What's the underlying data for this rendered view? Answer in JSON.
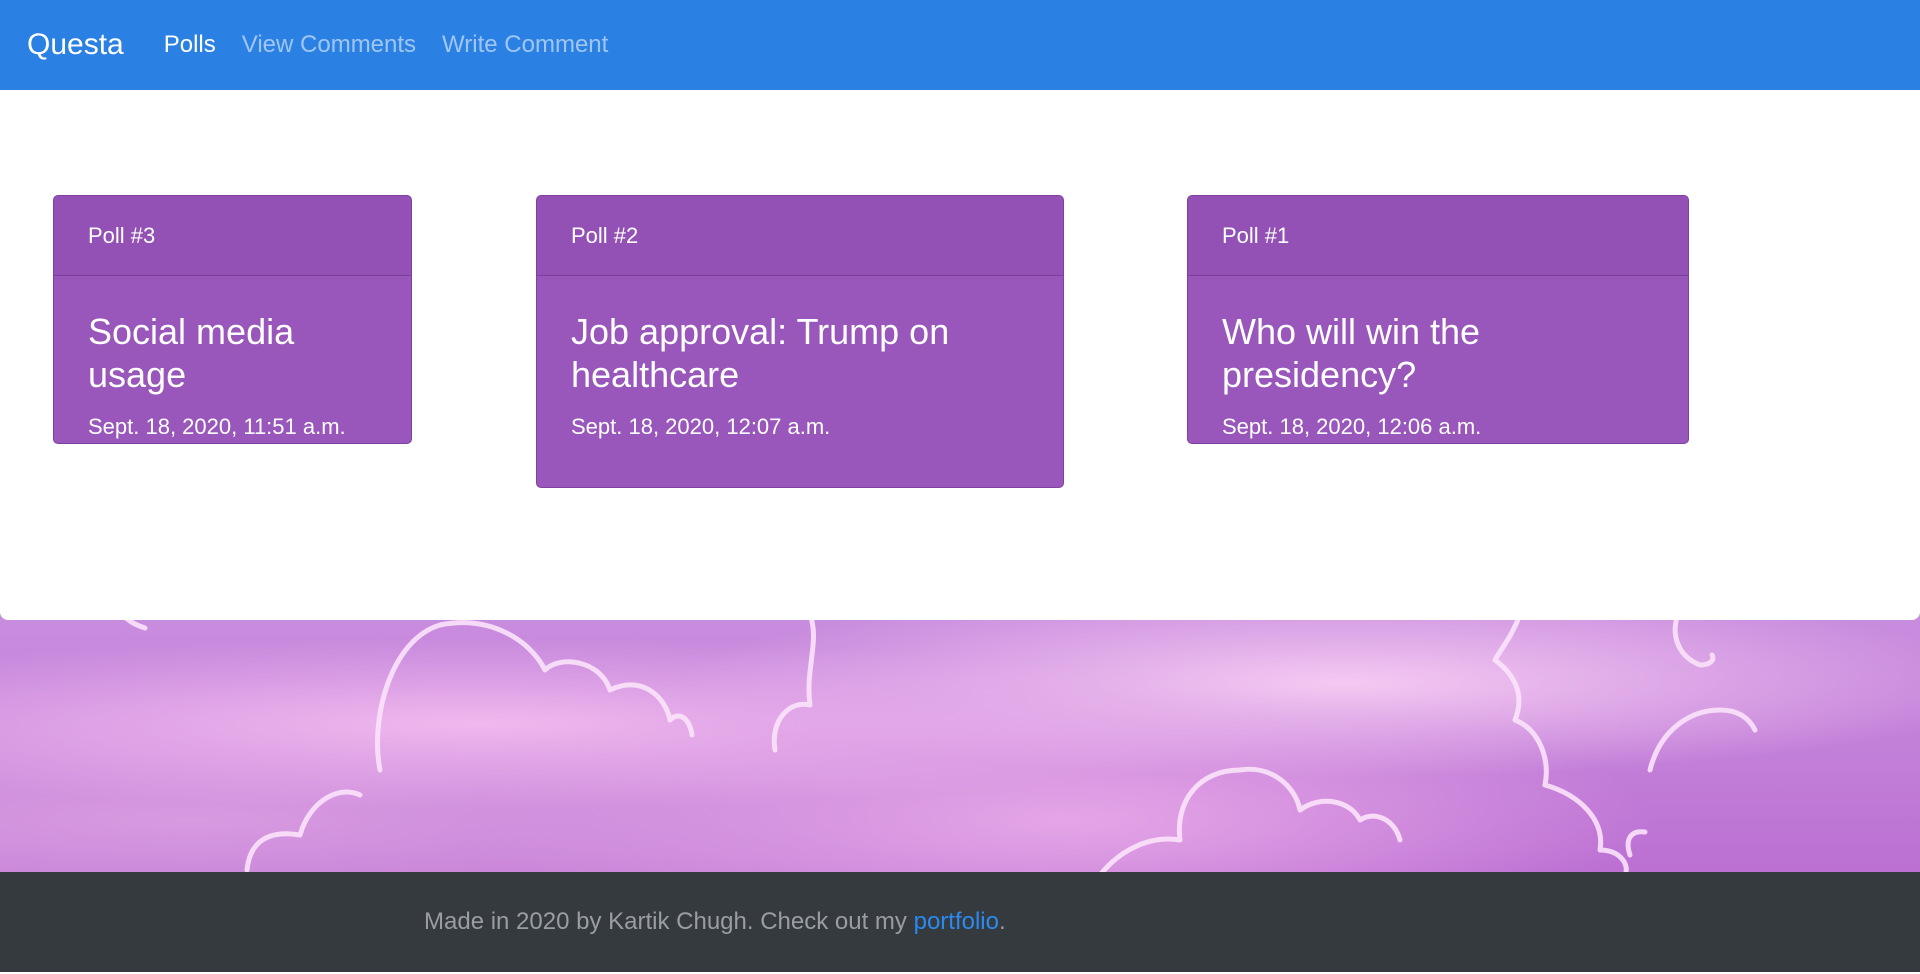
{
  "navbar": {
    "brand": "Questa",
    "links": [
      {
        "label": "Polls",
        "active": true
      },
      {
        "label": "View Comments",
        "active": false
      },
      {
        "label": "Write Comment",
        "active": false
      }
    ],
    "background_color": "#2a80e3"
  },
  "polls": [
    {
      "header": "Poll #3",
      "title": "Social media usage",
      "date": "Sept. 18, 2020, 11:51 a.m."
    },
    {
      "header": "Poll #2",
      "title": "Job approval: Trump on healthcare",
      "date": "Sept. 18, 2020, 12:07 a.m."
    },
    {
      "header": "Poll #1",
      "title": "Who will win the presidency?",
      "date": "Sept. 18, 2020, 12:06 a.m."
    }
  ],
  "card_color": "#9956bb",
  "footer": {
    "text_before": "Made in 2020 by Kartik Chugh. Check out my ",
    "link_label": "portfolio",
    "text_after": ".",
    "background_color": "#353a3e",
    "link_color": "#2b8af0"
  }
}
